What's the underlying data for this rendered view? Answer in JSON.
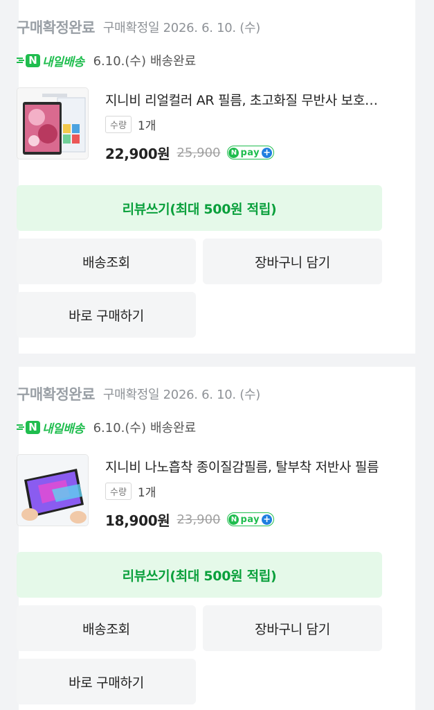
{
  "orders": [
    {
      "status": "구매확정완료",
      "confirm_date": "구매확정일 2026. 6. 10. (수)",
      "badge": "내일배송",
      "delivery_date": "6.10.(수)",
      "delivery_status": "배송완료",
      "product_name": "지니비 리얼컬러 AR 필름, 초고화질 무반사 보호필름",
      "qty_label": "수량",
      "qty_value": "1개",
      "price": "22,900원",
      "original_price": "25,900",
      "npay_label": "pay",
      "buttons": {
        "review": "리뷰쓰기(최대 500원 적립)",
        "track": "배송조회",
        "cart": "장바구니 담기",
        "buy_again": "바로 구매하기"
      }
    },
    {
      "status": "구매확정완료",
      "confirm_date": "구매확정일 2026. 6. 10. (수)",
      "badge": "내일배송",
      "delivery_date": "6.10.(수)",
      "delivery_status": "배송완료",
      "product_name": "지니비 나노흡착 종이질감필름, 탈부착 저반사 필름",
      "qty_label": "수량",
      "qty_value": "1개",
      "price": "18,900원",
      "original_price": "23,900",
      "npay_label": "pay",
      "buttons": {
        "review": "리뷰쓰기(최대 500원 적립)",
        "track": "배송조회",
        "cart": "장바구니 담기",
        "buy_again": "바로 구매하기"
      }
    }
  ],
  "colors": {
    "accent_green": "#1fbd4e",
    "review_bg": "#e5f9e9",
    "review_text": "#0aa03c",
    "npay_plus": "#1f7fe0",
    "page_bg": "#f2f3f5"
  },
  "icons": {
    "delivery_badge": "tomorrow-delivery-icon",
    "npay": "npay-logo-icon"
  }
}
